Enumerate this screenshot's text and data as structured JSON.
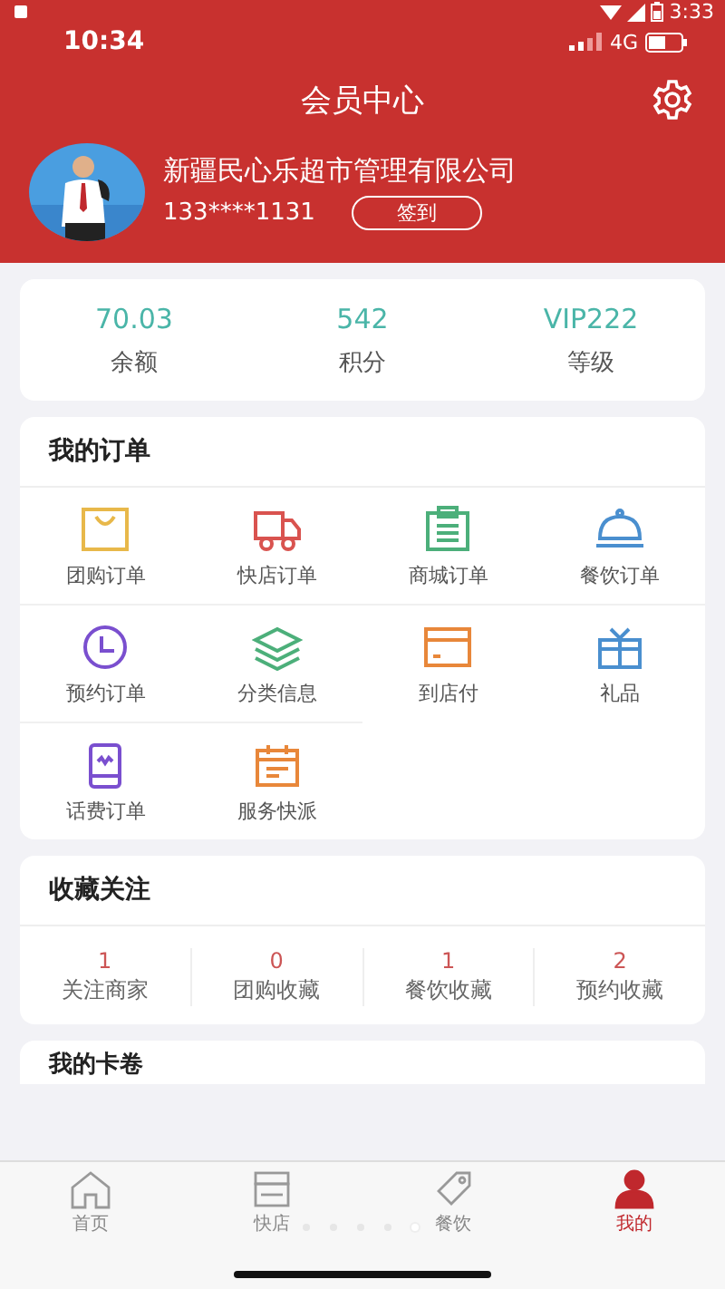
{
  "system_bar": {
    "time": "3:33"
  },
  "status_bar": {
    "time": "10:34",
    "network": "4G"
  },
  "header": {
    "title": "会员中心"
  },
  "profile": {
    "name": "新疆民心乐超市管理有限公司",
    "phone": "133****1131",
    "checkin_label": "签到"
  },
  "stats": [
    {
      "value": "70.03",
      "label": "余额"
    },
    {
      "value": "542",
      "label": "积分"
    },
    {
      "value": "VIP222",
      "label": "等级"
    }
  ],
  "orders": {
    "title": "我的订单",
    "items": [
      {
        "label": "团购订单",
        "kind": "bag",
        "color": "#e8b84a"
      },
      {
        "label": "快店订单",
        "kind": "truck",
        "color": "#d9534f"
      },
      {
        "label": "商城订单",
        "kind": "clipboard",
        "color": "#4caf7a"
      },
      {
        "label": "餐饮订单",
        "kind": "cloche",
        "color": "#4a8fcf"
      },
      {
        "label": "预约订单",
        "kind": "clock",
        "color": "#7a4fcf"
      },
      {
        "label": "分类信息",
        "kind": "layers",
        "color": "#4caf7a"
      },
      {
        "label": "到店付",
        "kind": "card",
        "color": "#e8873a"
      },
      {
        "label": "礼品",
        "kind": "gift",
        "color": "#4a8fcf"
      },
      {
        "label": "话费订单",
        "kind": "phone",
        "color": "#7a4fcf"
      },
      {
        "label": "服务快派",
        "kind": "calendar",
        "color": "#e8873a"
      }
    ]
  },
  "favorites": {
    "title": "收藏关注",
    "items": [
      {
        "count": "1",
        "label": "关注商家"
      },
      {
        "count": "0",
        "label": "团购收藏"
      },
      {
        "count": "1",
        "label": "餐饮收藏"
      },
      {
        "count": "2",
        "label": "预约收藏"
      }
    ]
  },
  "cards": {
    "title": "我的卡卷"
  },
  "tabbar": [
    {
      "label": "首页",
      "kind": "home",
      "selected": false
    },
    {
      "label": "快店",
      "kind": "shop",
      "selected": false
    },
    {
      "label": "餐饮",
      "kind": "tag",
      "selected": false
    },
    {
      "label": "我的",
      "kind": "user",
      "selected": true
    }
  ],
  "page_dots": [
    {
      "selected": false
    },
    {
      "selected": false
    },
    {
      "selected": false
    },
    {
      "selected": false
    },
    {
      "selected": true
    }
  ]
}
